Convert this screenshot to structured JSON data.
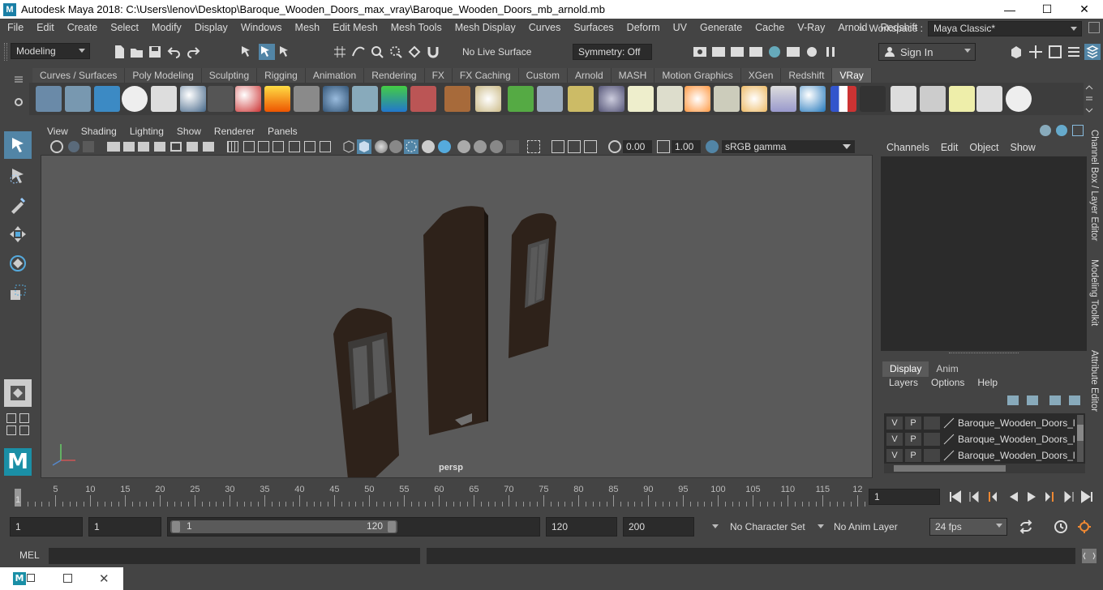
{
  "window": {
    "title": "Autodesk Maya 2018: C:\\Users\\lenov\\Desktop\\Baroque_Wooden_Doors_max_vray\\Baroque_Wooden_Doors_mb_arnold.mb",
    "app_icon_letter": "M",
    "min_symbol": "—",
    "max_symbol": "☐",
    "close_symbol": "✕"
  },
  "menubar": {
    "items": [
      "File",
      "Edit",
      "Create",
      "Select",
      "Modify",
      "Display",
      "Windows",
      "Mesh",
      "Edit Mesh",
      "Mesh Tools",
      "Mesh Display",
      "Curves",
      "Surfaces",
      "Deform",
      "UV",
      "Generate",
      "Cache",
      "V-Ray",
      "Arnold",
      "Redshift"
    ],
    "overflow": "»",
    "workspace_label": "Workspace :",
    "workspace_value": "Maya Classic*"
  },
  "statusline": {
    "mode": "Modeling",
    "live_surface": "No Live Surface",
    "symmetry": "Symmetry: Off",
    "sign_in": "Sign In"
  },
  "shelf": {
    "tabs": [
      "Curves / Surfaces",
      "Poly Modeling",
      "Sculpting",
      "Rigging",
      "Animation",
      "Rendering",
      "FX",
      "FX Caching",
      "Custom",
      "Arnold",
      "MASH",
      "Motion Graphics",
      "XGen",
      "Redshift",
      "VRay"
    ],
    "active_tab": "VRay"
  },
  "panel": {
    "menu": [
      "View",
      "Shading",
      "Lighting",
      "Show",
      "Renderer",
      "Panels"
    ],
    "exposure": "0.00",
    "gamma": "1.00",
    "color_space": "sRGB gamma",
    "camera_label": "persp"
  },
  "channelbox": {
    "menu": [
      "Channels",
      "Edit",
      "Object",
      "Show"
    ],
    "side_tabs": [
      "Channel Box / Layer Editor",
      "Modeling Toolkit",
      "Attribute Editor"
    ]
  },
  "layers": {
    "tabs": [
      "Display",
      "Anim"
    ],
    "active_tab": "Display",
    "menu": [
      "Layers",
      "Options",
      "Help"
    ],
    "rows": [
      {
        "v": "V",
        "p": "P",
        "name": "Baroque_Wooden_Doors_la"
      },
      {
        "v": "V",
        "p": "P",
        "name": "Baroque_Wooden_Doors_la"
      },
      {
        "v": "V",
        "p": "P",
        "name": "Baroque_Wooden_Doors_la"
      }
    ]
  },
  "timeline": {
    "ticks": [
      "1",
      "5",
      "10",
      "15",
      "20",
      "25",
      "30",
      "35",
      "40",
      "45",
      "50",
      "55",
      "60",
      "65",
      "70",
      "75",
      "80",
      "85",
      "90",
      "95",
      "100",
      "105",
      "110",
      "115",
      "12"
    ],
    "current_frame": "1"
  },
  "range": {
    "start": "1",
    "playback_start": "1",
    "slider_start": "1",
    "slider_end": "120",
    "playback_end": "120",
    "end": "200",
    "character_set": "No Character Set",
    "anim_layer": "No Anim Layer",
    "fps": "24 fps"
  },
  "cmdline": {
    "label": "MEL"
  },
  "colors": {
    "accent": "#5285a6",
    "door_wood": "#2e221a"
  }
}
